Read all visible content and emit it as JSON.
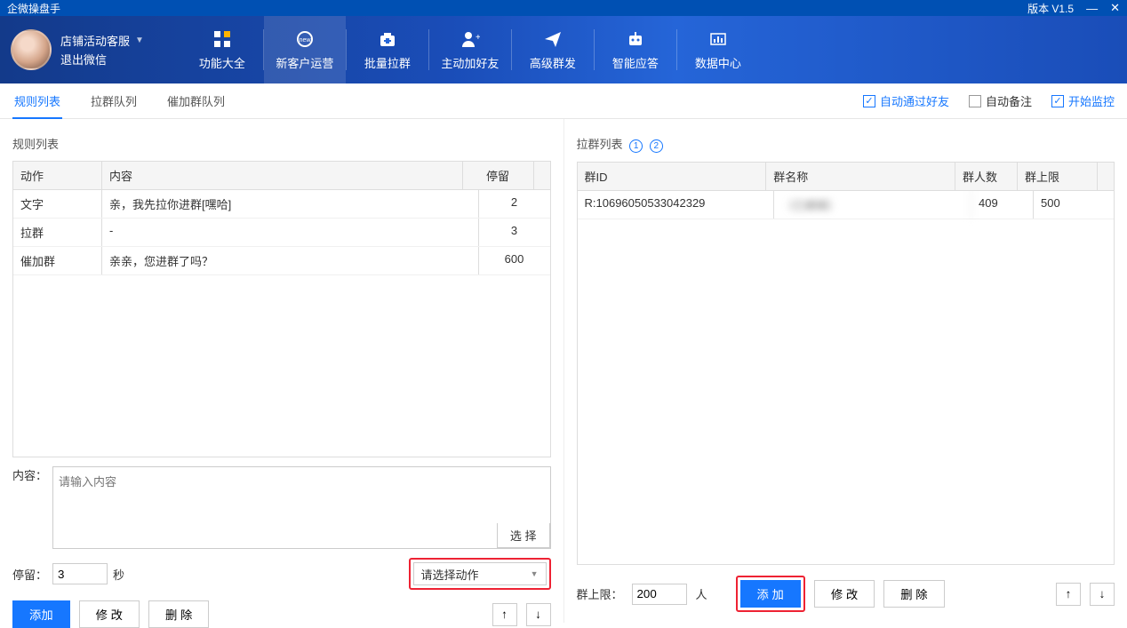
{
  "titlebar": {
    "app_name": "企微操盘手",
    "version": "版本 V1.5"
  },
  "profile": {
    "name": "店铺活动客服",
    "logout": "退出微信"
  },
  "nav": [
    {
      "label": "功能大全",
      "icon": "grid"
    },
    {
      "label": "新客户运营",
      "icon": "headset",
      "active": true
    },
    {
      "label": "批量拉群",
      "icon": "medkit"
    },
    {
      "label": "主动加好友",
      "icon": "add-user"
    },
    {
      "label": "高级群发",
      "icon": "send"
    },
    {
      "label": "智能应答",
      "icon": "robot"
    },
    {
      "label": "数据中心",
      "icon": "chart"
    }
  ],
  "subtabs": [
    {
      "label": "规则列表",
      "active": true
    },
    {
      "label": "拉群队列"
    },
    {
      "label": "催加群队列"
    }
  ],
  "checks": [
    {
      "label": "自动通过好友",
      "checked": true
    },
    {
      "label": "自动备注",
      "checked": false
    },
    {
      "label": "开始监控",
      "checked": true
    }
  ],
  "left": {
    "title": "规则列表",
    "columns": {
      "action": "动作",
      "content": "内容",
      "stay": "停留"
    },
    "rows": [
      {
        "action": "文字",
        "content": "亲，我先拉你进群[嘿哈]",
        "stay": "2"
      },
      {
        "action": "拉群",
        "content": "-",
        "stay": "3"
      },
      {
        "action": "催加群",
        "content": "亲亲，您进群了吗？",
        "stay": "600"
      }
    ],
    "content_label": "内容：",
    "content_placeholder": "请输入内容",
    "select_btn": "选 择",
    "stay_label": "停留：",
    "stay_value": "3",
    "stay_unit": "秒",
    "action_dropdown": "请选择动作",
    "buttons": {
      "add": "添加",
      "edit": "修 改",
      "del": "删 除"
    }
  },
  "right": {
    "title": "拉群列表",
    "columns": {
      "gid": "群ID",
      "gname": "群名称",
      "gcnt": "群人数",
      "gmax": "群上限"
    },
    "rows": [
      {
        "gid": "R:10696050533042329",
        "gname": "（已模糊）",
        "gcnt": "409",
        "gmax": "500"
      }
    ],
    "limit_label": "群上限：",
    "limit_value": "200",
    "limit_unit": "人",
    "buttons": {
      "add": "添 加",
      "edit": "修 改",
      "del": "删 除"
    }
  }
}
